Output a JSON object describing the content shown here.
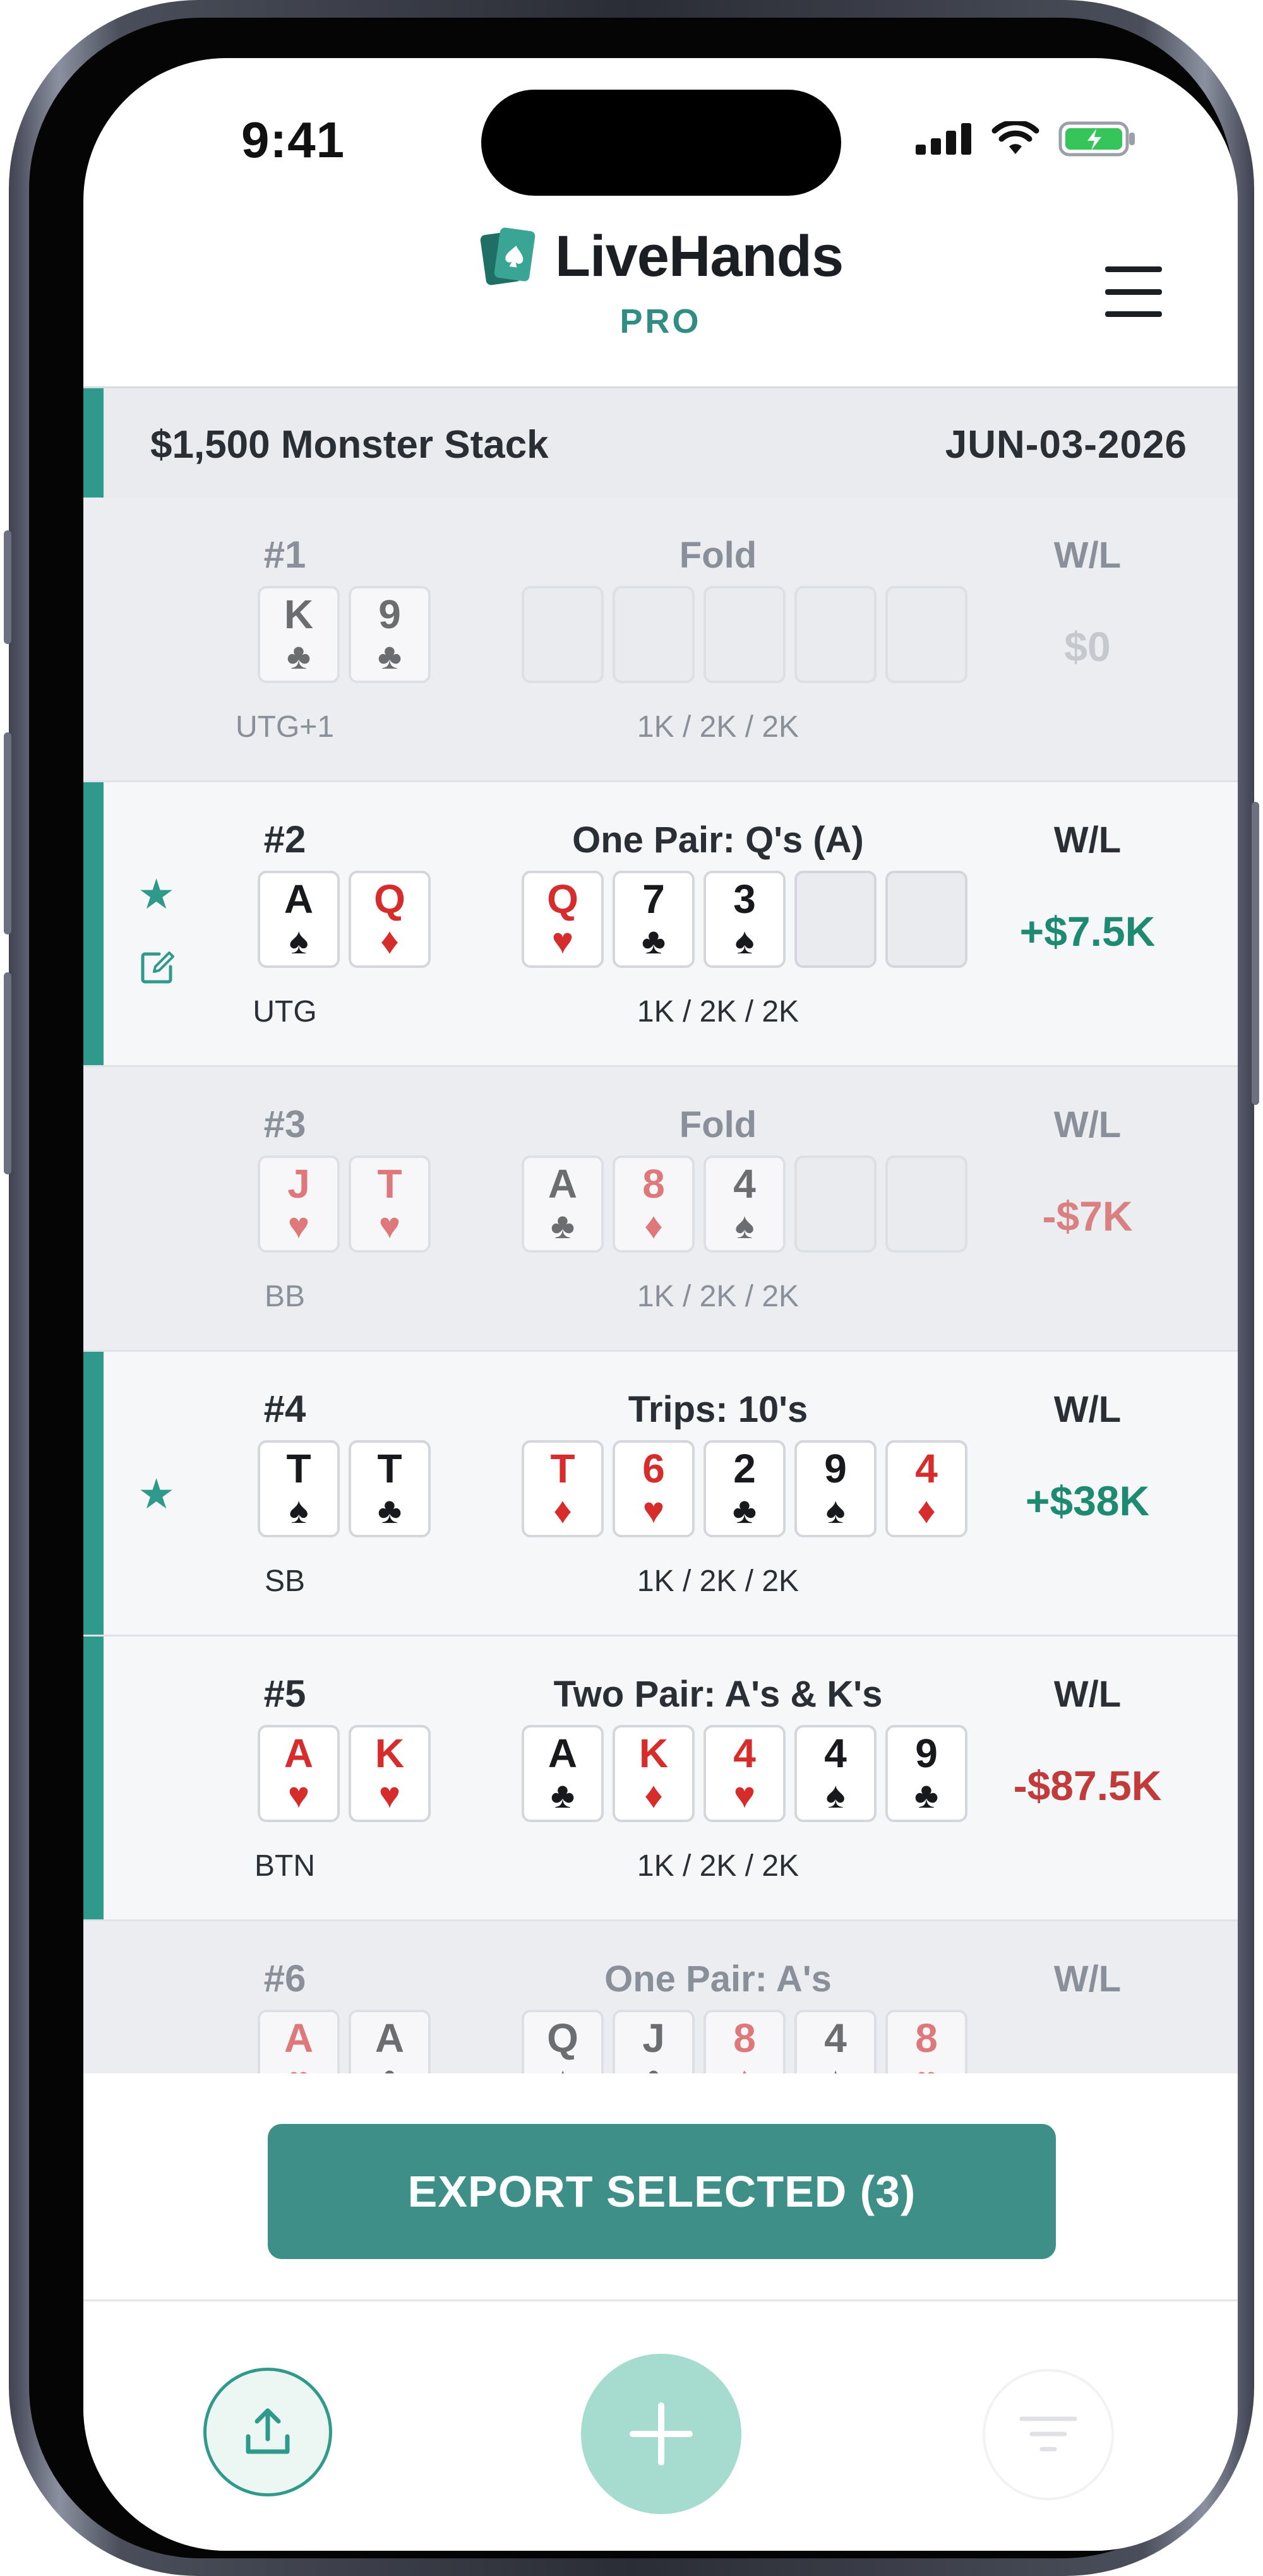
{
  "status_bar": {
    "time": "9:41"
  },
  "header": {
    "title": "LiveHands",
    "tier": "PRO"
  },
  "session": {
    "name": "$1,500 Monster Stack",
    "date": "JUN-03-2026"
  },
  "hands": [
    {
      "number": "#1",
      "result": "Fold",
      "wl_label": "W/L",
      "wl": "$0",
      "position": "UTG+1",
      "blinds": "1K / 2K / 2K",
      "hole": [
        {
          "rank": "K",
          "suit": "♣"
        },
        {
          "rank": "9",
          "suit": "♣"
        }
      ],
      "board": []
    },
    {
      "number": "#2",
      "result": "One Pair: Q's (A)",
      "wl_label": "W/L",
      "wl": "+$7.5K",
      "position": "UTG",
      "blinds": "1K / 2K / 2K",
      "hole": [
        {
          "rank": "A",
          "suit": "♠"
        },
        {
          "rank": "Q",
          "suit": "♦"
        }
      ],
      "board": [
        {
          "rank": "Q",
          "suit": "♥"
        },
        {
          "rank": "7",
          "suit": "♣"
        },
        {
          "rank": "3",
          "suit": "♠"
        }
      ]
    },
    {
      "number": "#3",
      "result": "Fold",
      "wl_label": "W/L",
      "wl": "-$7K",
      "position": "BB",
      "blinds": "1K / 2K / 2K",
      "hole": [
        {
          "rank": "J",
          "suit": "♥"
        },
        {
          "rank": "T",
          "suit": "♥"
        }
      ],
      "board": [
        {
          "rank": "A",
          "suit": "♣"
        },
        {
          "rank": "8",
          "suit": "♦"
        },
        {
          "rank": "4",
          "suit": "♠"
        }
      ]
    },
    {
      "number": "#4",
      "result": "Trips: 10's",
      "wl_label": "W/L",
      "wl": "+$38K",
      "position": "SB",
      "blinds": "1K / 2K / 2K",
      "hole": [
        {
          "rank": "T",
          "suit": "♠"
        },
        {
          "rank": "T",
          "suit": "♣"
        }
      ],
      "board": [
        {
          "rank": "T",
          "suit": "♦"
        },
        {
          "rank": "6",
          "suit": "♥"
        },
        {
          "rank": "2",
          "suit": "♣"
        },
        {
          "rank": "9",
          "suit": "♠"
        },
        {
          "rank": "4",
          "suit": "♦"
        }
      ]
    },
    {
      "number": "#5",
      "result": "Two Pair: A's & K's",
      "wl_label": "W/L",
      "wl": "-$87.5K",
      "position": "BTN",
      "blinds": "1K / 2K / 2K",
      "hole": [
        {
          "rank": "A",
          "suit": "♥"
        },
        {
          "rank": "K",
          "suit": "♥"
        }
      ],
      "board": [
        {
          "rank": "A",
          "suit": "♣"
        },
        {
          "rank": "K",
          "suit": "♦"
        },
        {
          "rank": "4",
          "suit": "♥"
        },
        {
          "rank": "4",
          "suit": "♠"
        },
        {
          "rank": "9",
          "suit": "♣"
        }
      ]
    },
    {
      "number": "#6",
      "result": "One Pair: A's",
      "wl_label": "W/L",
      "wl": "",
      "position": "",
      "blinds": "",
      "hole": [
        {
          "rank": "A",
          "suit": "♥"
        },
        {
          "rank": "A",
          "suit": "♣"
        }
      ],
      "board": [
        {
          "rank": "Q",
          "suit": "♠"
        },
        {
          "rank": "J",
          "suit": "♣"
        },
        {
          "rank": "8",
          "suit": "♦"
        },
        {
          "rank": "4",
          "suit": "♠"
        },
        {
          "rank": "8",
          "suit": "♥"
        }
      ]
    }
  ],
  "export_button": "EXPORT SELECTED (3)",
  "icons": {
    "logo": "card-logo-icon",
    "menu": "hamburger-menu-icon",
    "star": "star-icon",
    "edit": "edit-icon",
    "upload": "upload-icon",
    "add": "plus-icon",
    "filter": "filter-icon"
  },
  "colors": {
    "accent": "#2f9a8c",
    "positive": "#1f8a72",
    "negative": "#c23b3b",
    "export": "#3f8f89"
  }
}
